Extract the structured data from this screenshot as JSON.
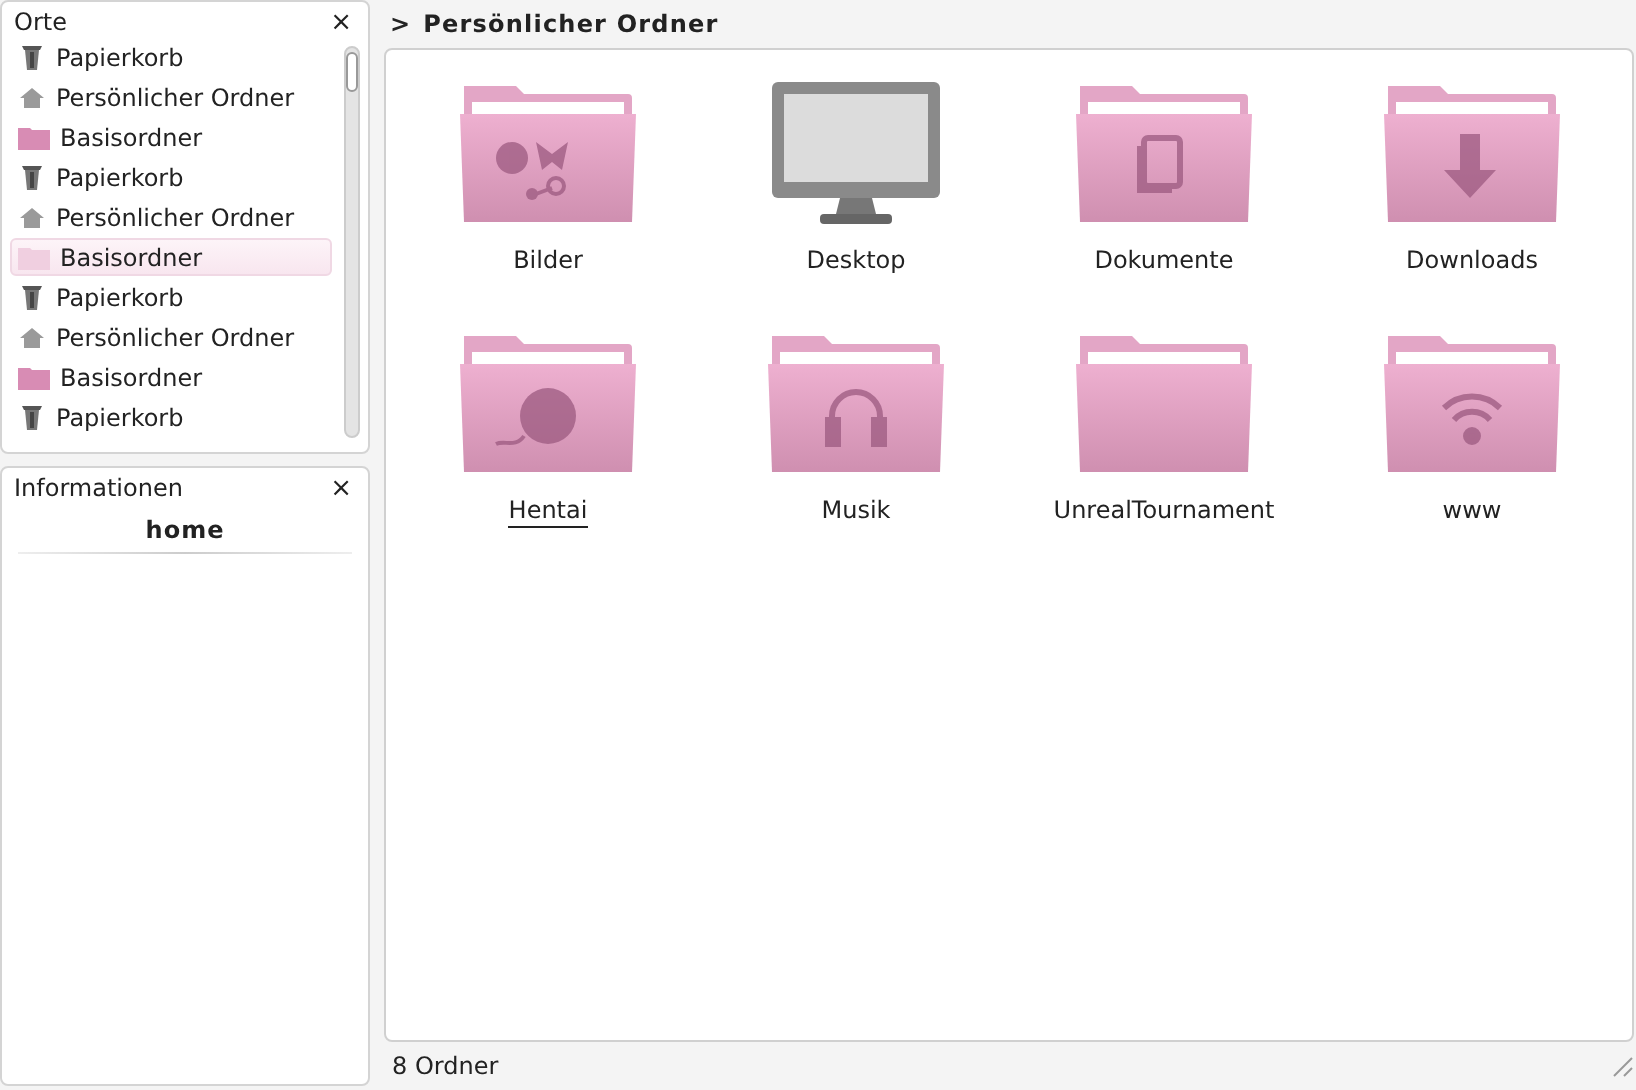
{
  "places": {
    "title": "Orte",
    "close": "×",
    "items": [
      {
        "label": "Papierkorb",
        "kind": "trash",
        "selected": false
      },
      {
        "label": "Persönlicher Ordner",
        "kind": "home",
        "selected": false
      },
      {
        "label": "Basisordner",
        "kind": "folder",
        "selected": false
      },
      {
        "label": "Papierkorb",
        "kind": "trash",
        "selected": false
      },
      {
        "label": "Persönlicher Ordner",
        "kind": "home",
        "selected": false
      },
      {
        "label": "Basisordner",
        "kind": "folder",
        "selected": true
      },
      {
        "label": "Papierkorb",
        "kind": "trash",
        "selected": false
      },
      {
        "label": "Persönlicher Ordner",
        "kind": "home",
        "selected": false
      },
      {
        "label": "Basisordner",
        "kind": "folder",
        "selected": false
      },
      {
        "label": "Papierkorb",
        "kind": "trash",
        "selected": false
      }
    ]
  },
  "info": {
    "title": "Informationen",
    "close": "×",
    "name": "home"
  },
  "breadcrumb": {
    "arrow": ">",
    "label": "Persönlicher Ordner"
  },
  "files": [
    {
      "label": "Bilder",
      "kind": "pictures",
      "hovered": false
    },
    {
      "label": "Desktop",
      "kind": "monitor",
      "hovered": false
    },
    {
      "label": "Dokumente",
      "kind": "documents",
      "hovered": false
    },
    {
      "label": "Downloads",
      "kind": "downloads",
      "hovered": false
    },
    {
      "label": "Hentai",
      "kind": "videos",
      "hovered": true
    },
    {
      "label": "Musik",
      "kind": "music",
      "hovered": false
    },
    {
      "label": "UnrealTournament",
      "kind": "plain",
      "hovered": false
    },
    {
      "label": "www",
      "kind": "web",
      "hovered": false
    }
  ],
  "status": "8 Ordner"
}
